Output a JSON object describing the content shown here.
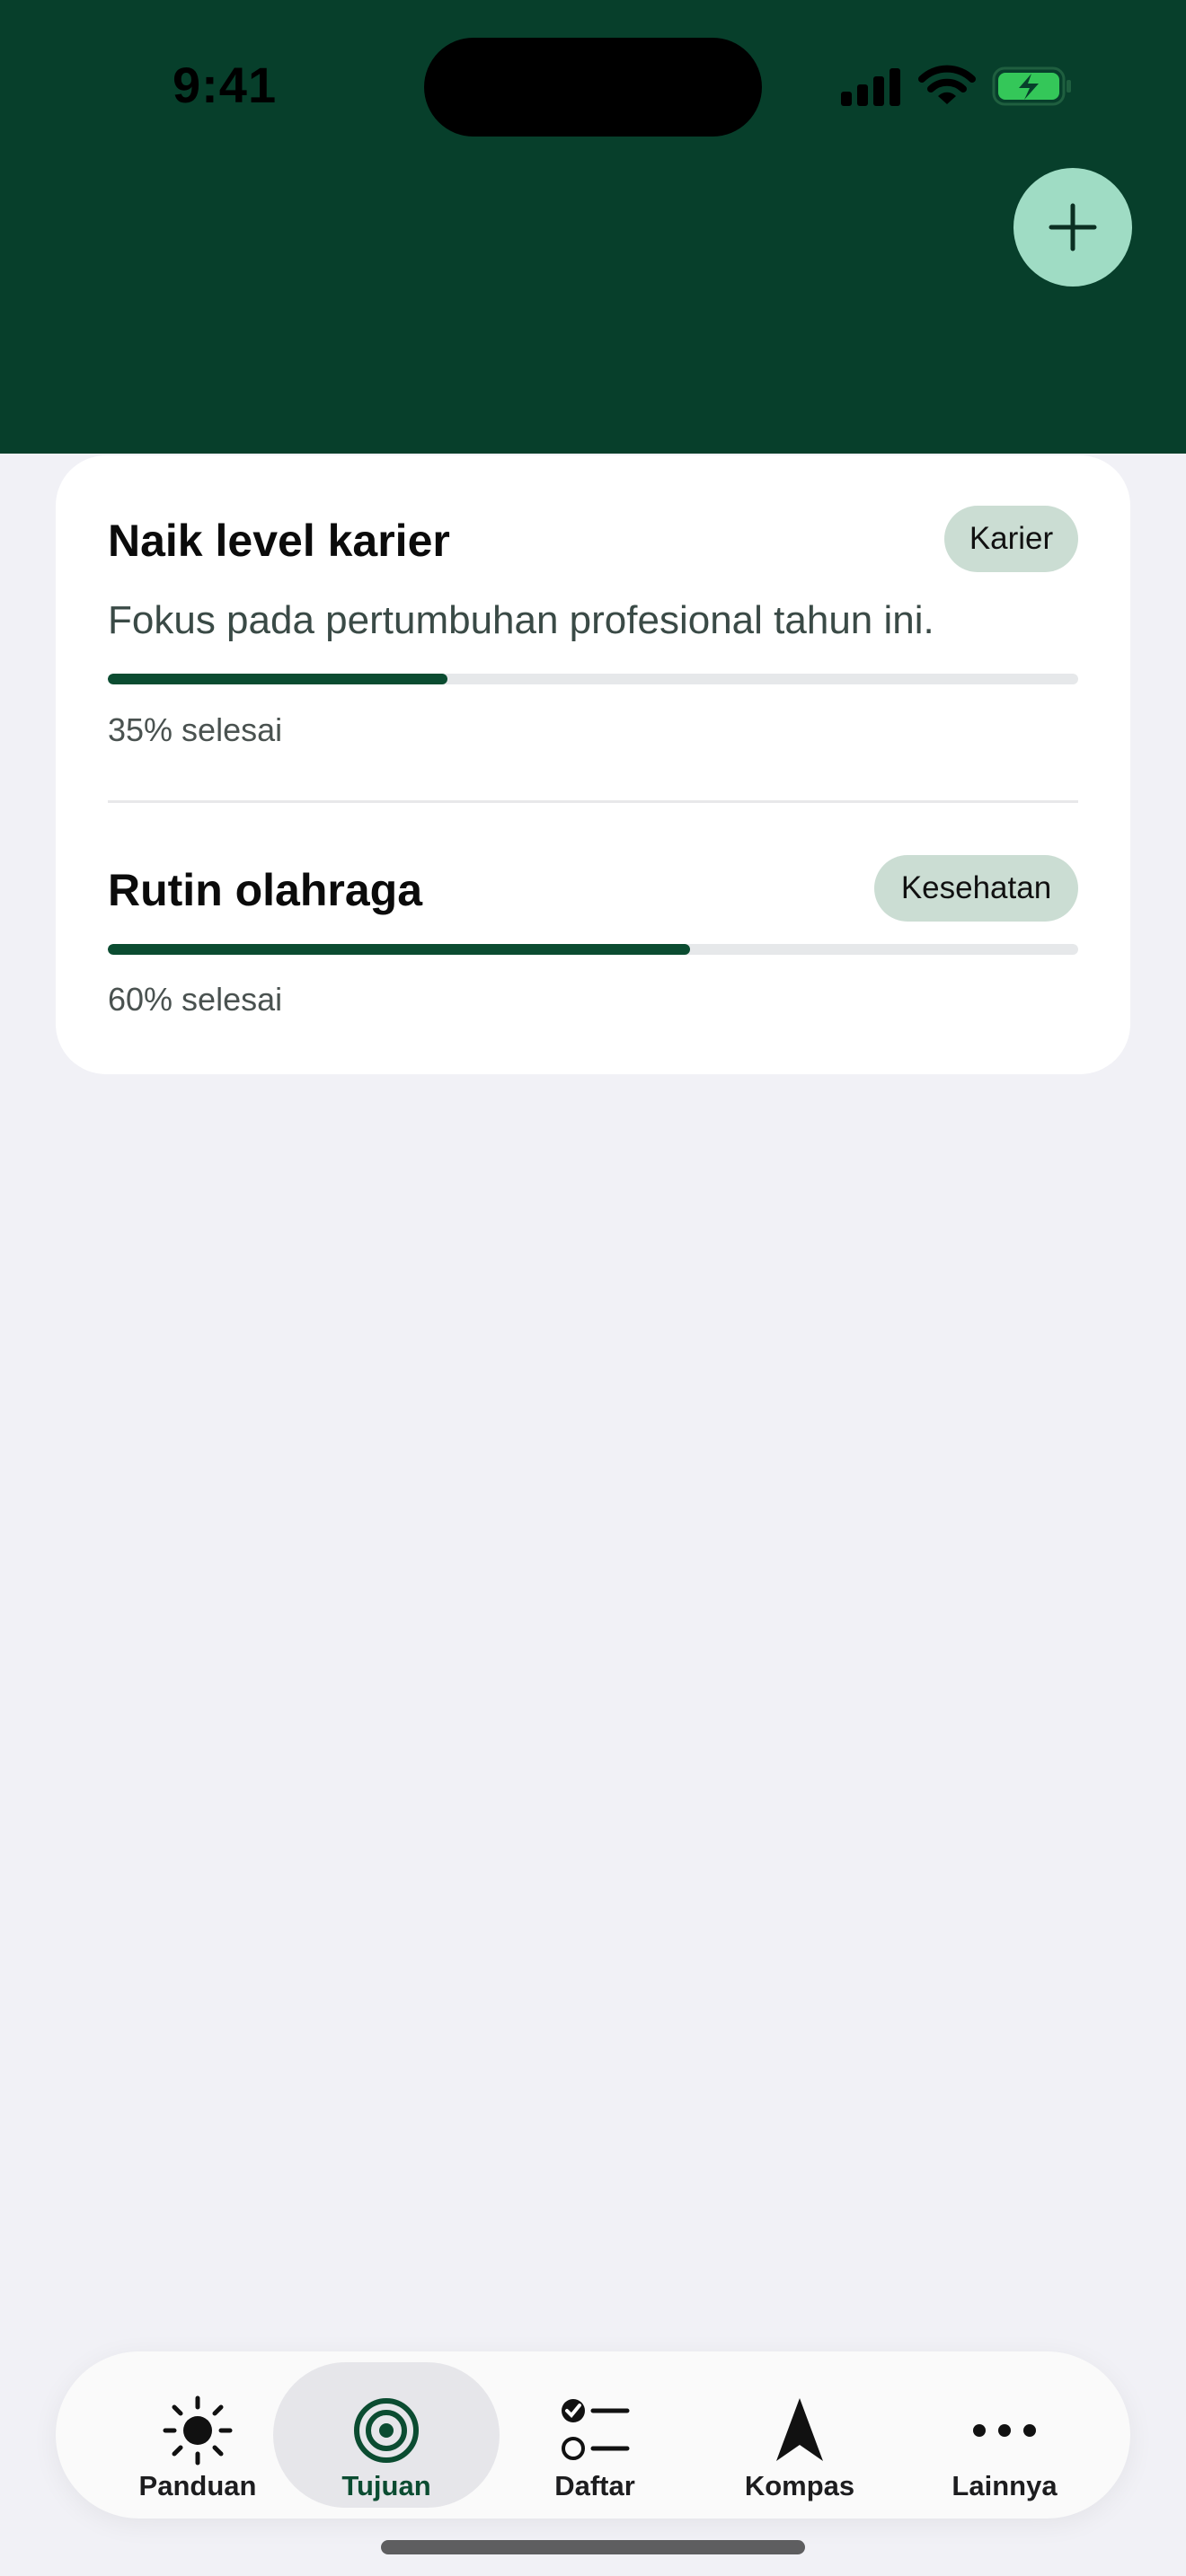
{
  "status_bar": {
    "time": "9:41"
  },
  "header": {
    "add_icon": "plus-icon",
    "background": "#073f2b"
  },
  "goals": [
    {
      "title": "Naik level karier",
      "tag": "Karier",
      "description": "Fokus pada pertumbuhan profesional tahun ini.",
      "progress": 0.35,
      "progress_label": "35% selesai"
    },
    {
      "title": "Rutin olahraga",
      "tag": "Kesehatan",
      "description": "",
      "progress": 0.6,
      "progress_label": "60% selesai"
    }
  ],
  "tab_bar": {
    "tabs": [
      {
        "label": "Panduan",
        "icon": "sun-icon",
        "active": false
      },
      {
        "label": "Tujuan",
        "icon": "target-icon",
        "active": true
      },
      {
        "label": "Daftar",
        "icon": "checklist-icon",
        "active": false
      },
      {
        "label": "Kompas",
        "icon": "navigation-arrow-icon",
        "active": false
      },
      {
        "label": "Lainnya",
        "icon": "more-icon",
        "active": false
      }
    ]
  },
  "colors": {
    "accent": "#0b4c31",
    "add_button": "#9fdcc4",
    "tag_bg": "#cbddd3"
  }
}
